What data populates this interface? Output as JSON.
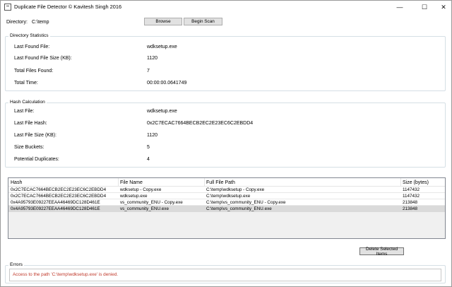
{
  "window": {
    "title": "Duplicate File Detector © Kavitesh Singh 2016",
    "controls": {
      "minimize": "—",
      "maximize": "☐",
      "close": "✕"
    }
  },
  "directory": {
    "label": "Directory:",
    "value": "C:\\temp",
    "browse_label": "Browse",
    "scan_label": "Begin Scan"
  },
  "stats": {
    "title": "Directory Statistics",
    "rows": [
      {
        "label": "Last Found File:",
        "value": "wdksetup.exe"
      },
      {
        "label": "Last Found File Size (KB):",
        "value": "1120"
      },
      {
        "label": "Total Files Found:",
        "value": "7"
      },
      {
        "label": "Total Time:",
        "value": "00:00:00.0641749"
      }
    ]
  },
  "hash": {
    "title": "Hash Calculation",
    "rows": [
      {
        "label": "Last File:",
        "value": "wdksetup.exe"
      },
      {
        "label": "Last File Hash:",
        "value": "0x2C7ECAC7664BECB2EC2E23EC6C2EBDD4"
      },
      {
        "label": "Last File Size (KB):",
        "value": "1120"
      },
      {
        "label": "Size Buckets:",
        "value": "5"
      },
      {
        "label": "Potential Duplicates:",
        "value": "4"
      }
    ]
  },
  "grid": {
    "columns": [
      "Hash",
      "File Name",
      "Full File Path",
      "Size (bytes)"
    ],
    "rows": [
      [
        "0x2C7ECAC7664BECB2EC2E23EC6C2EBDD4",
        "wdksetup - Copy.exe",
        "C:\\temp\\wdksetup - Copy.exe",
        "1147432"
      ],
      [
        "0x2C7ECAC7664BECB2EC2E23EC6C2EBDD4",
        "wdksetup.exe",
        "C:\\temp\\wdksetup.exe",
        "1147432"
      ],
      [
        "0x4A95793E09227EEAA46469DC128D461E",
        "vs_community_ENU - Copy.exe",
        "C:\\temp\\vs_community_ENU - Copy.exe",
        "213848"
      ],
      [
        "0x4A95793E09227EEAA46469DC128D461E",
        "vs_community_ENU.exe",
        "C:\\temp\\vs_community_ENU.exe",
        "213848"
      ]
    ],
    "selected_row": 3
  },
  "delete_label": "Delete Selected Items",
  "errors": {
    "title": "Errors",
    "message": "Access to the path 'C:\\temp\\wdksetup.exe' is denied.",
    "color": "#c0392b"
  }
}
